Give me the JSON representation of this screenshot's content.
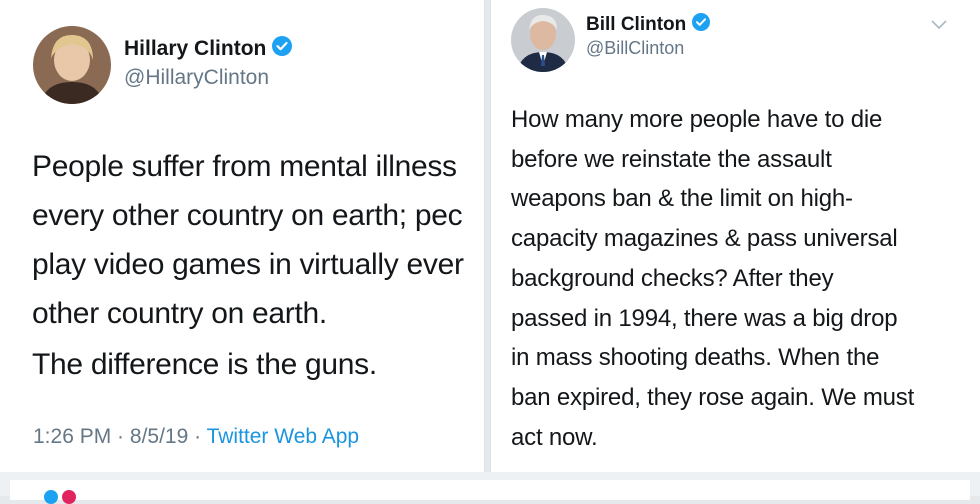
{
  "left_tweet": {
    "author_name": "Hillary Clinton",
    "handle": "@HillaryClinton",
    "lines": [
      "People suffer from mental illness",
      "every other country on earth; pec",
      "play video games in virtually ever",
      "other country on earth."
    ],
    "second_paragraph": "The difference is the guns.",
    "time": "1:26 PM",
    "date": "8/5/19",
    "separator": " · ",
    "source": "Twitter Web App"
  },
  "right_tweet": {
    "author_name": "Bill Clinton",
    "handle": "@BillClinton",
    "lines": [
      "How many more people have to die",
      "before we reinstate the assault",
      "weapons ban & the limit on high-",
      "capacity magazines & pass universal",
      "background checks? After they",
      "passed in 1994, there was a big drop",
      "in mass shooting deaths. When the",
      "ban expired, they rose again. We must",
      "act now."
    ]
  },
  "colors": {
    "verified_badge": "#1da1f2",
    "link": "#1b95e0",
    "secondary_text": "#657786"
  },
  "icons": [
    "verified-badge-icon",
    "chevron-down-icon"
  ]
}
